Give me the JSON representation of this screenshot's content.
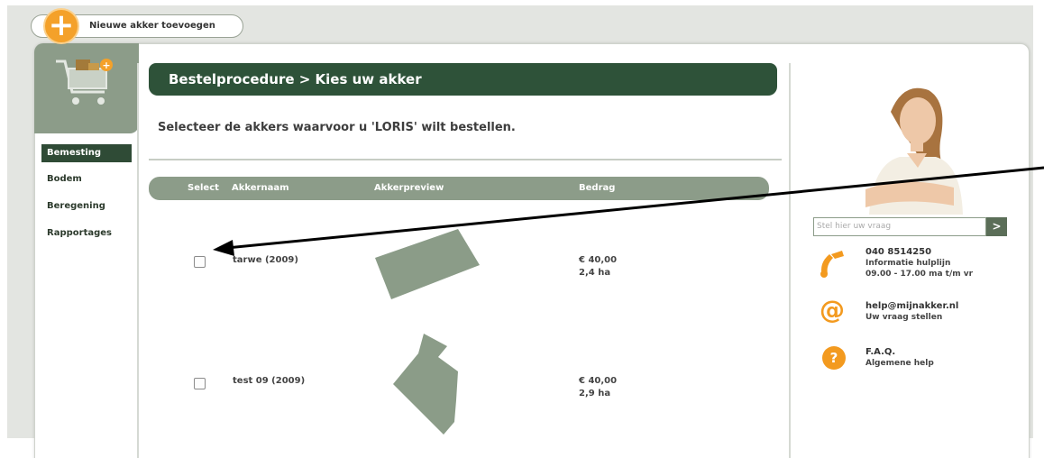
{
  "add_field": {
    "label": "Nieuwe akker toevoegen"
  },
  "sidebar": {
    "items": [
      {
        "label": "Bemesting",
        "active": true
      },
      {
        "label": "Bodem"
      },
      {
        "label": "Beregening"
      },
      {
        "label": "Rapportages"
      }
    ]
  },
  "main": {
    "title": "Bestelprocedure > Kies uw akker",
    "instruction": "Selecteer de akkers waarvoor u 'LORIS' wilt bestellen.",
    "columns": {
      "select": "Select",
      "name": "Akkernaam",
      "preview": "Akkerpreview",
      "amount": "Bedrag"
    },
    "rows": [
      {
        "name": "tarwe (2009)",
        "price": "€ 40,00",
        "area": "2,4 ha"
      },
      {
        "name": "test 09 (2009)",
        "price": "€ 40,00",
        "area": "2,9 ha"
      }
    ]
  },
  "help": {
    "search_placeholder": "Stel hier uw vraag",
    "search_button": ">",
    "phone": {
      "number": "040 8514250",
      "line1": "Informatie hulplijn",
      "line2": "09.00 - 17.00 ma t/m vr"
    },
    "email": {
      "address": "help@mijnakker.nl",
      "sub": "Uw vraag stellen"
    },
    "faq": {
      "title": "F.A.Q.",
      "sub": "Algemene help"
    }
  },
  "colors": {
    "accent": "#f4a12a",
    "dark_green": "#2e5239",
    "sage": "#8c9c89"
  }
}
